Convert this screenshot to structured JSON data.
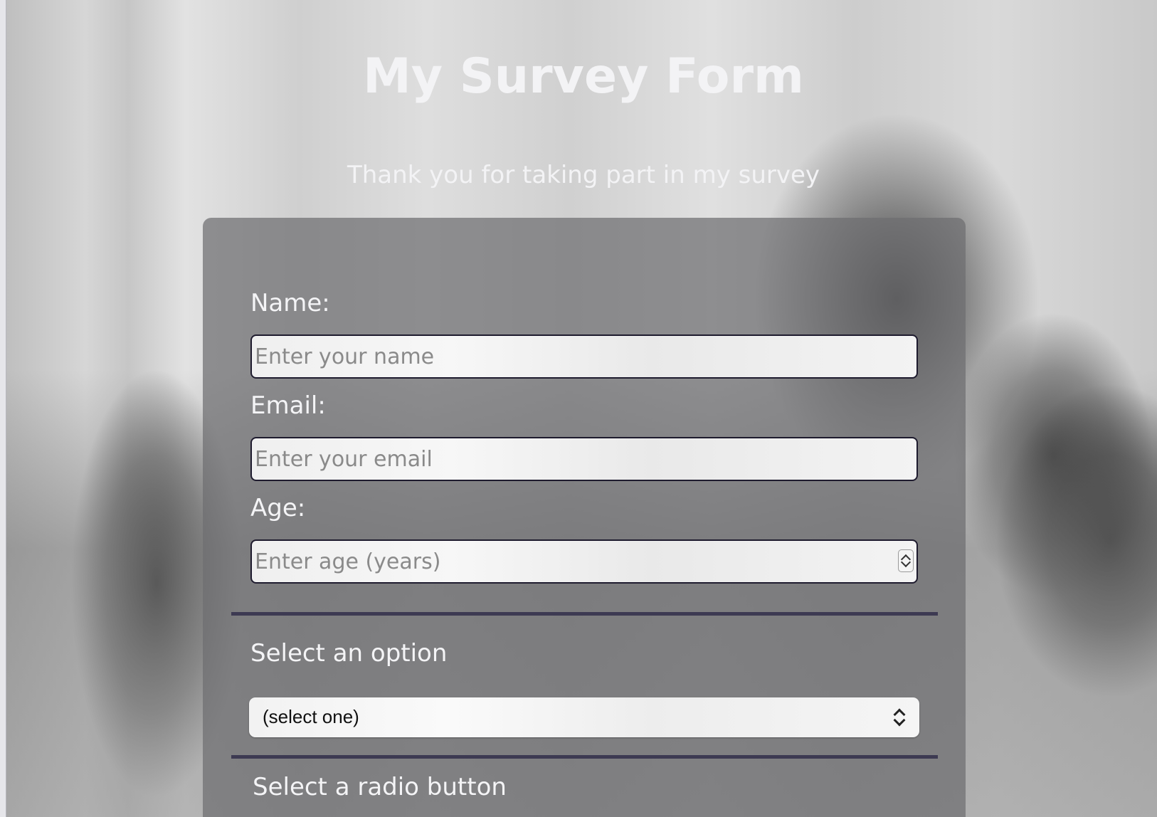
{
  "header": {
    "title": "My Survey Form",
    "description": "Thank you for taking part in my survey"
  },
  "form": {
    "name": {
      "label": "Name:",
      "placeholder": "Enter your name",
      "value": ""
    },
    "email": {
      "label": "Email:",
      "placeholder": "Enter your email",
      "value": ""
    },
    "age": {
      "label": "Age:",
      "placeholder": "Enter age (years)",
      "value": ""
    },
    "dropdown": {
      "label": "Select an option",
      "selected": "(select one)"
    },
    "radio": {
      "label": "Select a radio button"
    }
  },
  "colors": {
    "divider": "#3d3a52",
    "input_border": "#1e1b2e",
    "text_light": "#f4f4f6"
  }
}
